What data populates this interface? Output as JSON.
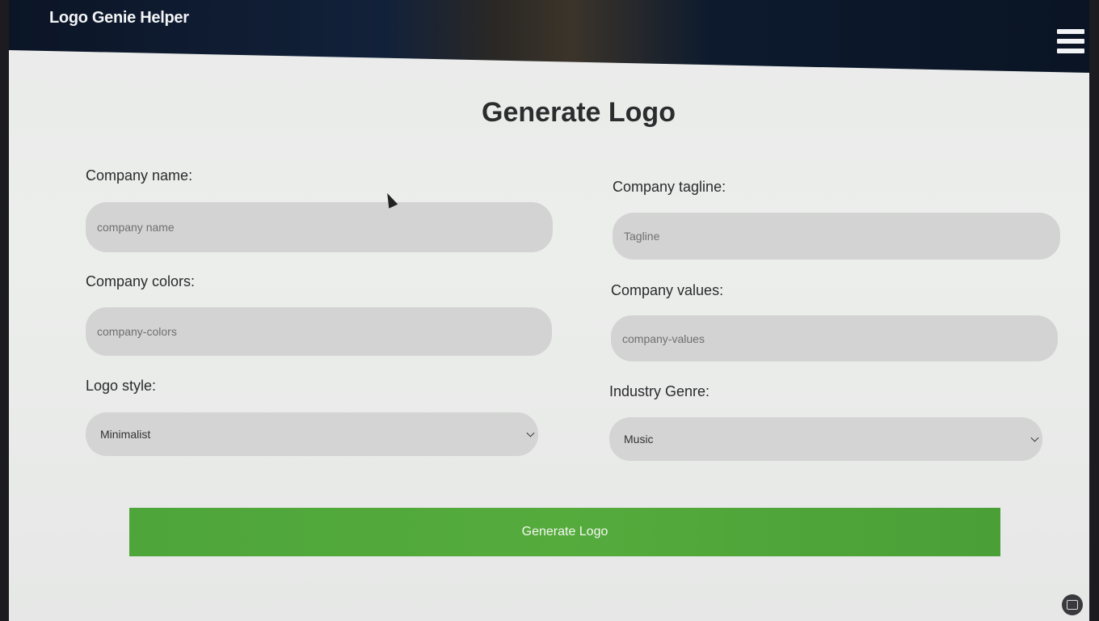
{
  "header": {
    "brand": "Logo Genie Helper",
    "menu_icon": "hamburger-menu-icon"
  },
  "main": {
    "title": "Generate Logo",
    "fields": {
      "company_name": {
        "label": "Company name:",
        "placeholder": "company name",
        "value": ""
      },
      "company_tagline": {
        "label": "Company tagline:",
        "placeholder": "Tagline",
        "value": ""
      },
      "company_colors": {
        "label": "Company colors:",
        "placeholder": "company-colors",
        "value": ""
      },
      "company_values": {
        "label": "Company values:",
        "placeholder": "company-values",
        "value": ""
      },
      "logo_style": {
        "label": "Logo style:",
        "selected": "Minimalist"
      },
      "industry_genre": {
        "label": "Industry Genre:",
        "selected": "Music"
      }
    },
    "submit_label": "Generate Logo",
    "accent_color": "#55ab3c"
  }
}
